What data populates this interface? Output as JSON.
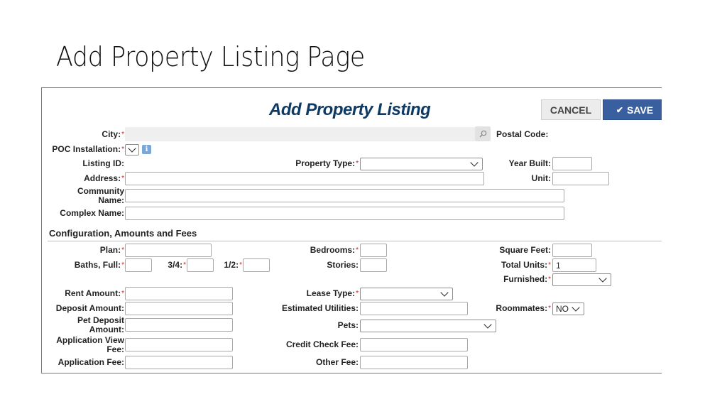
{
  "slide": {
    "title": "Add Property Listing Page"
  },
  "form": {
    "title": "Add Property Listing",
    "buttons": {
      "cancel": "CANCEL",
      "save": "SAVE"
    },
    "fields": {
      "city": {
        "label": "City:",
        "value": ""
      },
      "postal_code": {
        "label": "Postal Code:"
      },
      "poc_installation": {
        "label": "POC Installation:",
        "value": ""
      },
      "listing_id": {
        "label": "Listing ID:"
      },
      "property_type": {
        "label": "Property Type:",
        "value": ""
      },
      "year_built": {
        "label": "Year Built:",
        "value": ""
      },
      "address": {
        "label": "Address:",
        "value": ""
      },
      "unit": {
        "label": "Unit:",
        "value": ""
      },
      "community_name": {
        "label_line1": "Community",
        "label_line2": "Name:",
        "value": ""
      },
      "complex_name": {
        "label": "Complex Name:",
        "value": ""
      }
    },
    "section": {
      "title": "Configuration, Amounts and Fees",
      "fields": {
        "plan": {
          "label": "Plan:",
          "value": ""
        },
        "bedrooms": {
          "label": "Bedrooms:",
          "value": ""
        },
        "square_feet": {
          "label": "Square Feet:",
          "value": ""
        },
        "baths_full": {
          "label": "Baths, Full:",
          "value": ""
        },
        "baths_three_quarter": {
          "label": "3/4:",
          "value": ""
        },
        "baths_half": {
          "label": "1/2:",
          "value": ""
        },
        "stories": {
          "label": "Stories:",
          "value": ""
        },
        "total_units": {
          "label": "Total Units:",
          "value": "1"
        },
        "furnished": {
          "label": "Furnished:",
          "value": ""
        },
        "rent_amount": {
          "label": "Rent Amount:",
          "value": ""
        },
        "lease_type": {
          "label": "Lease Type:",
          "value": ""
        },
        "deposit_amount": {
          "label": "Deposit Amount:",
          "value": ""
        },
        "estimated_utilities": {
          "label": "Estimated Utilities:",
          "value": ""
        },
        "roommates": {
          "label": "Roommates:",
          "value": "NO"
        },
        "pet_deposit": {
          "label_line1": "Pet Deposit",
          "label_line2": "Amount:",
          "value": ""
        },
        "pets": {
          "label": "Pets:",
          "value": ""
        },
        "application_view_fee": {
          "label_line1": "Application View",
          "label_line2": "Fee:",
          "value": ""
        },
        "credit_check_fee": {
          "label": "Credit Check Fee:",
          "value": ""
        },
        "application_fee": {
          "label": "Application Fee:",
          "value": ""
        },
        "other_fee": {
          "label": "Other Fee:",
          "value": ""
        }
      }
    },
    "required_marker": "*",
    "icons": {
      "search": "search-icon",
      "info": "info-icon",
      "check": "check-icon",
      "dropdown": "chevron-down-icon"
    }
  }
}
